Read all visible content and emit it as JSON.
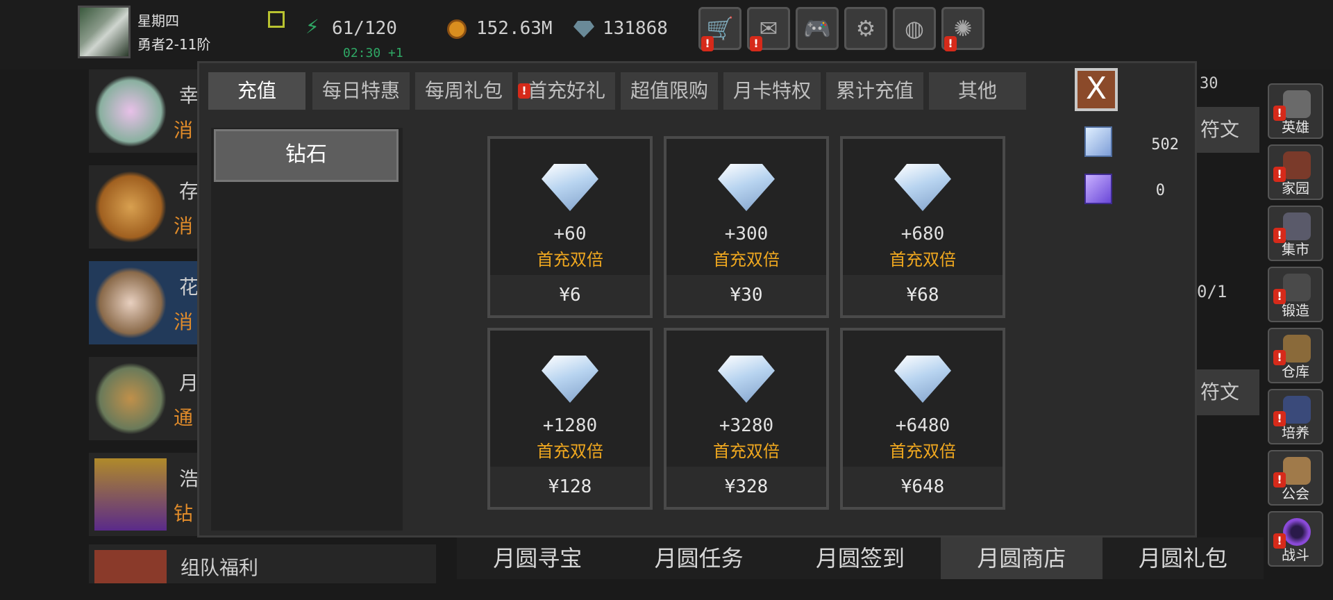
{
  "player": {
    "day": "星期四",
    "rank": "勇者2-11阶"
  },
  "resources": {
    "energy": "61/120",
    "regen": "02:30 +1",
    "gold": "152.63M",
    "gems": "131868"
  },
  "left_list": [
    {
      "title": "幸",
      "sub": "消"
    },
    {
      "title": "存",
      "sub": "消"
    },
    {
      "title": "花",
      "sub": "消"
    },
    {
      "title": "月",
      "sub": "通"
    },
    {
      "title": "浩",
      "sub": "钻"
    },
    {
      "title": "组队福利",
      "sub": ""
    }
  ],
  "background_fragments": {
    "f1": "30",
    "f2": "符文",
    "f3": "0/1",
    "f4": "符文"
  },
  "sidebar": [
    "英雄",
    "家园",
    "集市",
    "锻造",
    "仓库",
    "培养",
    "公会",
    "战斗"
  ],
  "bottom_tabs": [
    "月圆寻宝",
    "月圆任务",
    "月圆签到",
    "月圆商店",
    "月圆礼包"
  ],
  "modal": {
    "tabs": [
      "充值",
      "每日特惠",
      "每周礼包",
      "首充好礼",
      "超值限购",
      "月卡特权",
      "累计充值",
      "其他"
    ],
    "category": "钻石",
    "close_label": "X",
    "currency": [
      {
        "value": "502"
      },
      {
        "value": "0"
      }
    ],
    "items": [
      {
        "amount": "+60",
        "bonus": "首充双倍",
        "price": "¥6"
      },
      {
        "amount": "+300",
        "bonus": "首充双倍",
        "price": "¥30"
      },
      {
        "amount": "+680",
        "bonus": "首充双倍",
        "price": "¥68"
      },
      {
        "amount": "+1280",
        "bonus": "首充双倍",
        "price": "¥128"
      },
      {
        "amount": "+3280",
        "bonus": "首充双倍",
        "price": "¥328"
      },
      {
        "amount": "+6480",
        "bonus": "首充双倍",
        "price": "¥648"
      }
    ]
  },
  "alert_symbol": "!",
  "colors": {
    "bonus": "#f0a81f",
    "alert": "#d62a1a",
    "energy": "#2fa865"
  },
  "icons": {
    "top_buttons": [
      "cart-icon",
      "mail-icon",
      "gamepad-icon",
      "gear-icon",
      "color-wheel-icon",
      "fireworks-icon"
    ]
  }
}
